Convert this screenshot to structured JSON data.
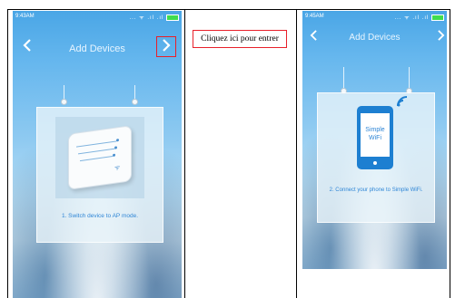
{
  "table": {
    "callout_text": "Cliquez ici pour entrer"
  },
  "screen1": {
    "status_time": "9:43AM",
    "status_icons": "... ᯤ .ıl .ıl",
    "nav_title": "Add Devices",
    "back_icon": "chevron-left-icon",
    "next_icon": "chevron-right-icon",
    "caption": "1. Switch device to AP mode.",
    "highlight_color": "#e8202a"
  },
  "screen2": {
    "status_time": "9:45AM",
    "status_icons": "... ᯤ .ıl .ıl",
    "nav_title": "Add Devices",
    "back_icon": "chevron-left-icon",
    "next_icon": "chevron-right-icon",
    "phone_label_line1": "Simple",
    "phone_label_line2": "WiFi",
    "caption": "2. Connect your phone to Simple WiFi."
  },
  "colors": {
    "accent_blue": "#2f86d6",
    "phone_blue": "#1d7fd1",
    "battery_green": "#3fdc4f"
  }
}
